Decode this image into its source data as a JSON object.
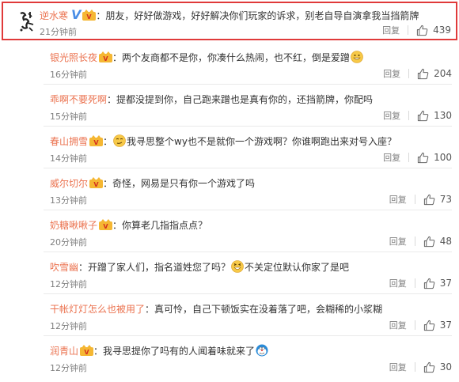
{
  "top_comment": {
    "username": "逆水寒",
    "text": "朋友，好好做游戏，好好解决你们玩家的诉求，别老自导自演拿我当挡箭牌",
    "time": "21分钟前",
    "reply_label": "回复",
    "likes": "439"
  },
  "replies": [
    {
      "username": "银光照长夜",
      "text": "两个友商都不是你，你凑什么热闹，也不红，倒是爱蹭",
      "time": "16分钟前",
      "reply_label": "回复",
      "likes": "204",
      "crown": true,
      "emoji_end": "grin-emoji"
    },
    {
      "username": "乖啊不要死啊",
      "text": "提都没提到你，自己跑来蹭也是真有你的，还挡箭牌，你配吗",
      "time": "15分钟前",
      "reply_label": "回复",
      "likes": "130",
      "crown": false
    },
    {
      "username": "春山拥雪",
      "text": "我寻思整个wy也不是就你一个游戏啊？你谁啊跑出来对号入座？",
      "time": "14分钟前",
      "reply_label": "回复",
      "likes": "100",
      "crown": true,
      "emoji_start": "smirk-emoji"
    },
    {
      "username": "威尔切尔",
      "text": "奇怪，网易是只有你一个游戏了吗",
      "time": "13分钟前",
      "reply_label": "回复",
      "likes": "73",
      "crown": true
    },
    {
      "username": "奶糖啾啾子",
      "text": "你算老几指指点点？",
      "time": "20分钟前",
      "reply_label": "回复",
      "likes": "48",
      "crown": true
    },
    {
      "username": "吹雪幽",
      "text_before": "开蹭了家人们，指名道姓您了吗？",
      "text": "不关定位默认你家了是吧",
      "time": "12分钟前",
      "reply_label": "回复",
      "likes": "37",
      "crown": false,
      "emoji_mid": "laugh-emoji"
    },
    {
      "username": "干帐灯灯怎么也被用了",
      "text": "真可怜，自己下顿饭实在没着落了吧，会糊稀的小浆糊",
      "time": "12分钟前",
      "reply_label": "回复",
      "likes": "37",
      "crown": false
    },
    {
      "username": "润青山",
      "text": "我寻思提你了吗有的人闻着味就来了",
      "time": "12分钟前",
      "reply_label": "回复",
      "likes": "30",
      "crown": true,
      "emoji_end": "doraemon-emoji"
    }
  ],
  "colors": {
    "username": "#eb7350",
    "highlight_border": "#e03a3a",
    "meta": "#808080"
  }
}
